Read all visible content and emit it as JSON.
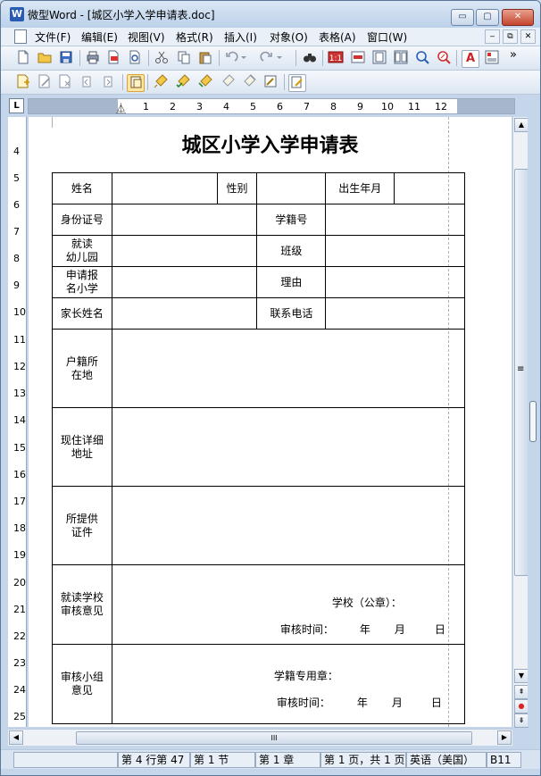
{
  "window": {
    "app_icon_letter": "W",
    "title": "微型Word - [城区小学入学申请表.doc]",
    "min_label": "▭",
    "max_label": "▢",
    "close_label": "✕"
  },
  "menu": {
    "items": [
      "文件(F)",
      "编辑(E)",
      "视图(V)",
      "格式(R)",
      "插入(I)",
      "对象(O)",
      "表格(A)",
      "窗口(W)"
    ],
    "mdi_buttons": [
      "‒",
      "⧉",
      "✕"
    ]
  },
  "toolbar1": {
    "icons": [
      "new-document-icon",
      "open-folder-icon",
      "save-icon",
      "print-icon",
      "export-pdf-icon",
      "print-preview-icon",
      "cut-icon",
      "copy-icon",
      "paste-icon",
      "undo-icon",
      "redo-icon",
      "find-icon",
      "actual-size-icon",
      "fit-width-icon",
      "one-page-icon",
      "two-page-icon",
      "zoom-icon",
      "zoom-percent-icon",
      "font-color-icon",
      "insert-picture-icon"
    ],
    "overflow": "»",
    "actual_size_text": "1:1",
    "font_color_text": "A"
  },
  "toolbar2": {
    "icons": [
      "new-comment-icon",
      "edit-comment-icon",
      "delete-comment-icon",
      "prev-comment-icon",
      "next-comment-icon",
      "track-changes-icon",
      "highlighter-icon",
      "accept-change-icon",
      "reject-change-icon",
      "accept-all-icon",
      "reject-all-icon",
      "review-pane-icon"
    ]
  },
  "ruler": {
    "corner": "L",
    "numbers": [
      "1",
      "2",
      "3",
      "4",
      "5",
      "6",
      "7",
      "8",
      "9",
      "10",
      "11",
      "12"
    ],
    "vertical_numbers": [
      "4",
      "5",
      "6",
      "7",
      "8",
      "9",
      "10",
      "11",
      "12",
      "13",
      "14",
      "15",
      "16",
      "17",
      "18",
      "19",
      "20",
      "21",
      "22",
      "23",
      "24",
      "25"
    ]
  },
  "document": {
    "title": "城区小学入学申请表",
    "row1": {
      "name": "姓名",
      "gender": "性别",
      "birth": "出生年月"
    },
    "row2": {
      "id": "身份证号",
      "student_no": "学籍号"
    },
    "row3": {
      "kindergarten_1": "就读",
      "kindergarten_2": "幼儿园",
      "class": "班级"
    },
    "row4": {
      "school_1": "申请报",
      "school_2": "名小学",
      "reason": "理由"
    },
    "row5": {
      "parent": "家长姓名",
      "phone": "联系电话"
    },
    "row6": {
      "l1": "户籍所",
      "l2": "在地"
    },
    "row7": {
      "l1": "现住详细",
      "l2": "地址"
    },
    "row8": {
      "l1": "所提供",
      "l2": "证件"
    },
    "row9": {
      "l1": "就读学校",
      "l2": "审核意见",
      "seal": "学校（公章）：",
      "date_label": "审核时间：",
      "year": "年",
      "month": "月",
      "day": "日"
    },
    "row10": {
      "l1": "审核小组",
      "l2": "意见",
      "seal": "学籍专用章：",
      "date_label": "审核时间：",
      "year": "年",
      "month": "月",
      "day": "日"
    }
  },
  "scrollbars": {
    "up": "▲",
    "down": "▼",
    "grip": "≡",
    "left": "◀",
    "right": "▶",
    "hgrip": "III",
    "prev_page": "⇞",
    "browse": "●",
    "next_page": "⇟"
  },
  "status": {
    "row_col": "第 4 行第 47",
    "section": "第 1 节",
    "chapter": "第 1 章",
    "page": "第 1 页，共 1 页",
    "language": "英语（美国）",
    "mode": "B11"
  }
}
